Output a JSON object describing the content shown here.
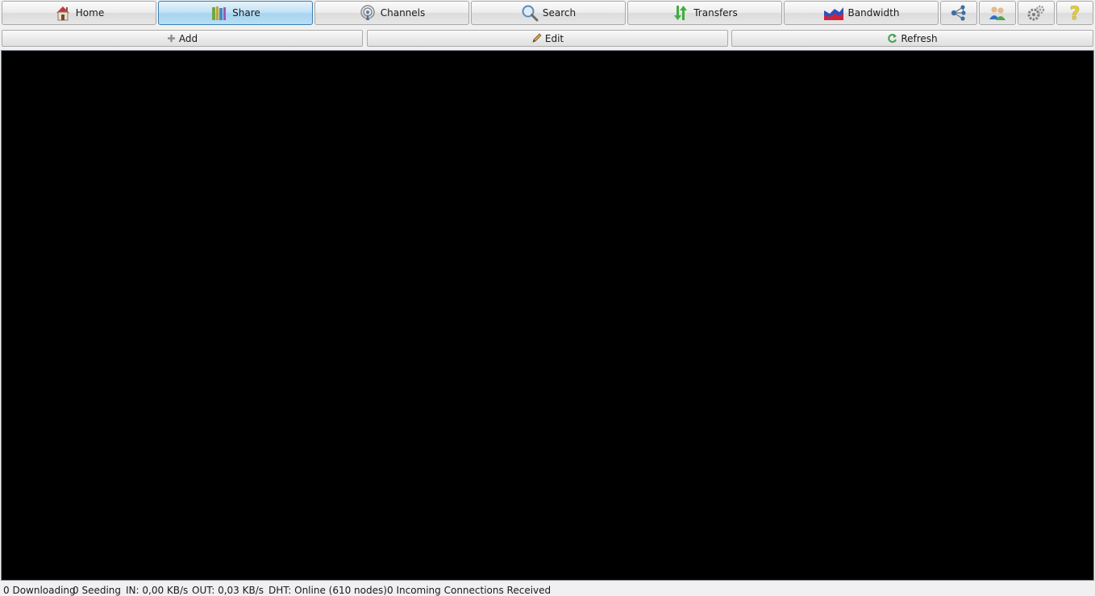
{
  "toolbar": {
    "tabs": [
      {
        "label": "Home",
        "icon": "home-icon",
        "active": false
      },
      {
        "label": "Share",
        "icon": "books-icon",
        "active": true
      },
      {
        "label": "Channels",
        "icon": "antenna-icon",
        "active": false
      },
      {
        "label": "Search",
        "icon": "magnifier-icon",
        "active": false
      },
      {
        "label": "Transfers",
        "icon": "transfer-arrows-icon",
        "active": false
      },
      {
        "label": "Bandwidth",
        "icon": "bandwidth-chart-icon",
        "active": false
      }
    ],
    "icon_buttons": [
      "network-nodes-icon",
      "users-icon",
      "settings-gears-icon",
      "help-question-icon"
    ]
  },
  "subtoolbar": {
    "add_label": "Add",
    "edit_label": "Edit",
    "refresh_label": "Refresh"
  },
  "status": {
    "downloading": "0 Downloading",
    "seeding": "0 Seeding",
    "in_rate": "IN: 0,00 KB/s",
    "out_rate": "OUT: 0,03 KB/s",
    "dht": "DHT: Online (610 nodes)",
    "incoming": "0 Incoming Connections Received"
  },
  "colors": {
    "active_tab": "#a6d4ef",
    "content_bg": "#000000"
  }
}
